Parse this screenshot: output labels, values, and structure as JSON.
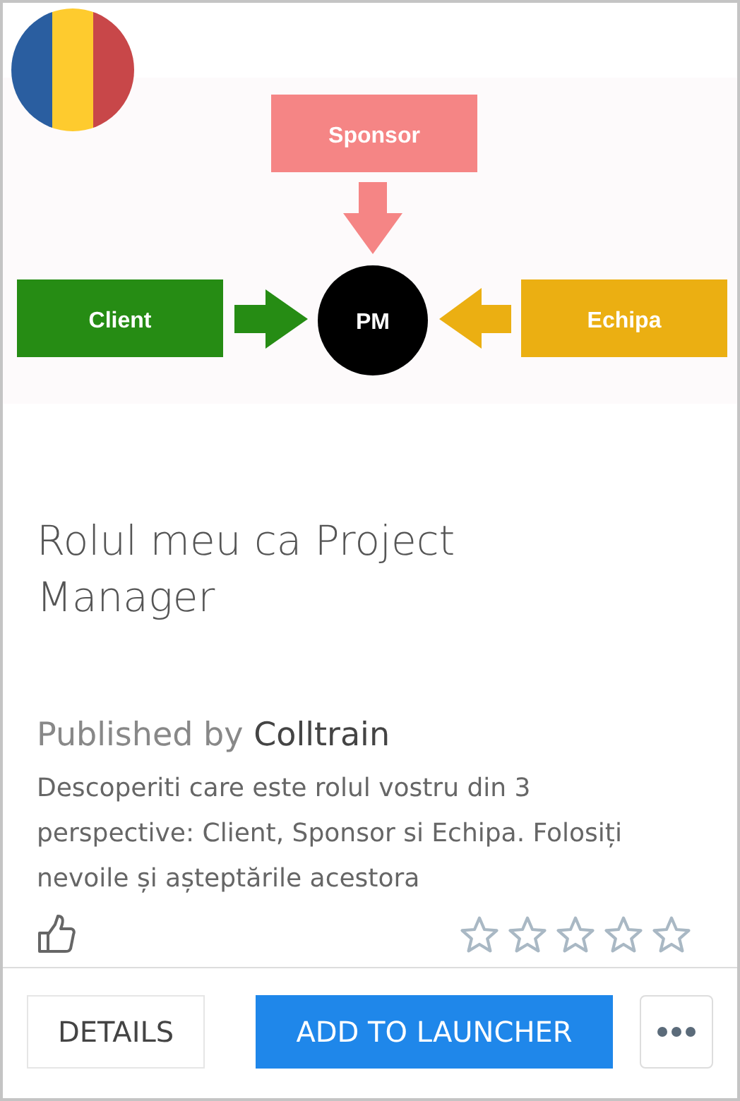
{
  "diagram": {
    "nodes": [
      {
        "kind": "box",
        "label": "Sponsor",
        "color": "#f58585"
      },
      {
        "kind": "box",
        "label": "Client",
        "color": "#268c14"
      },
      {
        "kind": "circle",
        "label": "PM",
        "color": "#000000"
      },
      {
        "kind": "box",
        "label": "Echipa",
        "color": "#ebaf12"
      }
    ]
  },
  "title": "Rolul meu ca Project Manager",
  "publisher": {
    "label": "Published by",
    "name": "Colltrain"
  },
  "description": "Descoperiti care este rolul vostru din 3 perspective: Client, Sponsor si Echipa. Folosiți nevoile și așteptările acestora",
  "stars": 0,
  "buttons": {
    "details": "DETAILS",
    "add": "ADD TO LAUNCHER"
  }
}
